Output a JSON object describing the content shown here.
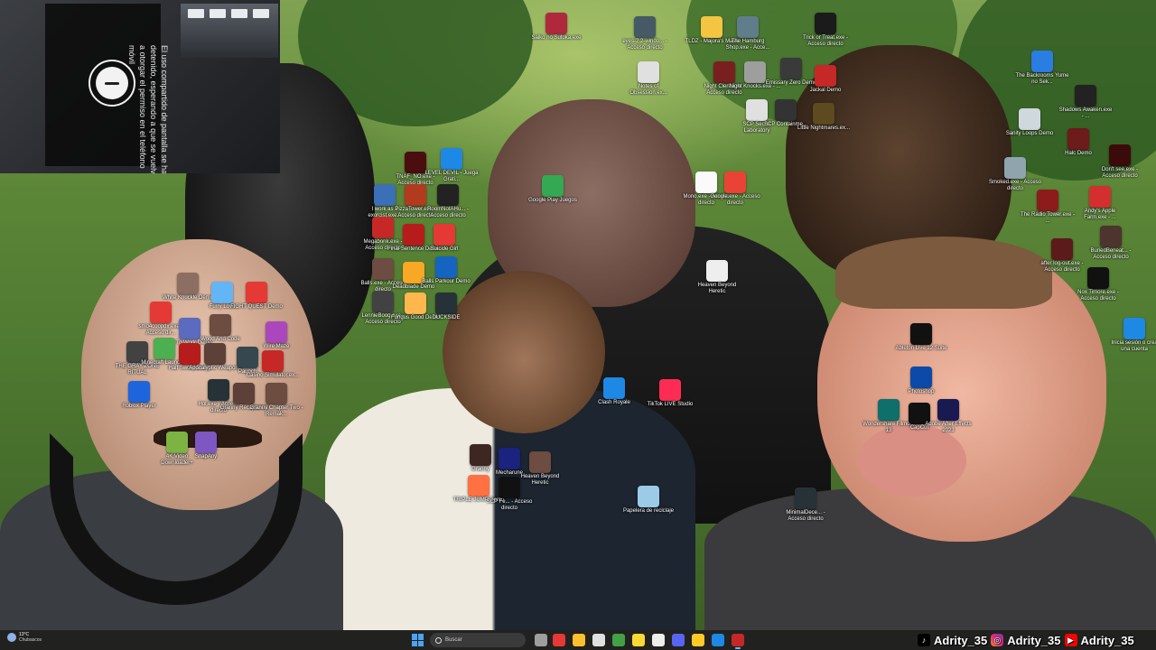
{
  "colors": {
    "taskbar_bg": "#202020",
    "accent": "#4ca3f0",
    "icon_label": "#ffffff"
  },
  "webcam": {
    "text": "El uso compartido de pantalla se ha detenido, esperando a que se vuelva a otorgar el permiso en el teléfono móvil",
    "icon": "screen-share-paused-icon"
  },
  "desktop_icons": [
    {
      "id": "saiko",
      "label": "Saiko no Sutoka.exe",
      "color": "#b0283c",
      "icon": "game-icon"
    },
    {
      "id": "eyes",
      "label": "eyes-2.2-windo... - Acceso directo",
      "color": "#455a64",
      "icon": "unity-icon"
    },
    {
      "id": "tldz",
      "label": "TLDZ - Majora's Mask",
      "color": "#f4c542",
      "icon": "folder-icon"
    },
    {
      "id": "hamburgshop",
      "label": "The Hamburg Shop.exe - Acce...",
      "color": "#607d8b",
      "icon": "unity-icon"
    },
    {
      "id": "trickortreat",
      "label": "Trick or Treat.exe - Acceso directo",
      "color": "#1b1b1b",
      "icon": "game-icon"
    },
    {
      "id": "backrooms",
      "label": "The Backrooms Yume no Sek...",
      "color": "#2a7de1",
      "icon": "game-icon"
    },
    {
      "id": "notesobsession",
      "label": "Notes of Obsession.ex...",
      "color": "#e0e0e0",
      "icon": "game-icon"
    },
    {
      "id": "nightclerk",
      "label": "Night Clerk.exe - Acceso directo",
      "color": "#7a1f1f",
      "icon": "game-icon"
    },
    {
      "id": "nightknocks",
      "label": "Night Knocks.exe - ...",
      "color": "#9e9e9e",
      "icon": "unity-icon"
    },
    {
      "id": "emissaryzero",
      "label": "Emissary Zero Demo",
      "color": "#3a3a3a",
      "icon": "game-icon"
    },
    {
      "id": "jackal",
      "label": "Jackal Demo",
      "color": "#c62828",
      "icon": "game-icon"
    },
    {
      "id": "shadowsawaken",
      "label": "Shadows Awaken.exe - ...",
      "color": "#222222",
      "icon": "game-icon"
    },
    {
      "id": "scpsecret",
      "label": "SCP Secret Laboratory",
      "color": "#e0e0e0",
      "icon": "game-icon"
    },
    {
      "id": "scpcontain",
      "label": "SCP Containme...",
      "color": "#333333",
      "icon": "game-icon"
    },
    {
      "id": "littlenightmares",
      "label": "Little Nightmares.ex...",
      "color": "#5d4a1f",
      "icon": "game-icon"
    },
    {
      "id": "sanityloops",
      "label": "Sanity Loops Demo",
      "color": "#cfd8dc",
      "icon": "game-icon"
    },
    {
      "id": "halcdemo",
      "label": "Halc Demo",
      "color": "#6d1b1b",
      "icon": "game-icon"
    },
    {
      "id": "dontsee",
      "label": "Don't see.exe - Acceso directo",
      "color": "#3b0a0a",
      "icon": "game-icon"
    },
    {
      "id": "tnaf",
      "label": "TNAF_NO.exe - Acceso directo",
      "color": "#4a0e0e",
      "icon": "game-icon"
    },
    {
      "id": "leveldevil",
      "label": "LEVEL DEVIL - Juega Grati...",
      "color": "#1e88e5",
      "icon": "edge-icon"
    },
    {
      "id": "googleplay",
      "label": "Google Play Juegos",
      "color": "#34a853",
      "icon": "google-play-icon"
    },
    {
      "id": "mono",
      "label": "Mono.exe - Acceso directo",
      "color": "#fafafa",
      "icon": "game-icon"
    },
    {
      "id": "googleexe",
      "label": "Google.exe - Acceso directo",
      "color": "#ea4335",
      "icon": "google-icon"
    },
    {
      "id": "smoked",
      "label": "Smoked.exe - Acceso directo",
      "color": "#90a4ae",
      "icon": "unity-icon"
    },
    {
      "id": "theradiotower",
      "label": "The Radio Tower.exe - ...",
      "color": "#8e1b1b",
      "icon": "game-icon"
    },
    {
      "id": "andysapple",
      "label": "Andy's Apple Farm.exe - ...",
      "color": "#d32f2f",
      "icon": "game-icon"
    },
    {
      "id": "iworkasa",
      "label": "I work as a exorcist.exe...",
      "color": "#3b6fb6",
      "icon": "game-icon"
    },
    {
      "id": "pizzatower",
      "label": "PizzaTower.exe - Acceso directo",
      "color": "#b23a1e",
      "icon": "game-icon"
    },
    {
      "id": "roomnot",
      "label": "RoomNotAHu... - Acceso directo",
      "color": "#222222",
      "icon": "game-icon"
    },
    {
      "id": "megabonk",
      "label": "Megabonk.exe - Acceso directo",
      "color": "#c62828",
      "icon": "game-icon"
    },
    {
      "id": "finalsentence",
      "label": "Final Sentence Demo",
      "color": "#b71c1c",
      "icon": "game-icon"
    },
    {
      "id": "suicidegirl",
      "label": "Suicide Girl",
      "color": "#e53935",
      "icon": "game-icon"
    },
    {
      "id": "buriedbeneath",
      "label": "BuriedBeneat... - Acceso directo",
      "color": "#4e342e",
      "icon": "game-icon"
    },
    {
      "id": "afterlogout",
      "label": "after log-out.exe - Acceso directo",
      "color": "#5d1a1a",
      "icon": "game-icon"
    },
    {
      "id": "heavenbeyond",
      "label": "Heaven Beyond Heretic",
      "color": "#eeeeee",
      "icon": "game-icon"
    },
    {
      "id": "nostimore",
      "label": "Nox Timore.exe - Acceso directo",
      "color": "#111111",
      "icon": "game-icon"
    },
    {
      "id": "balls",
      "label": "Balls.exe - Acceso directo",
      "color": "#6d4c41",
      "icon": "game-icon"
    },
    {
      "id": "deadblade",
      "label": "Deadblade Demo",
      "color": "#f9a825",
      "icon": "game-icon"
    },
    {
      "id": "ballsparkour",
      "label": "Balls Parkour Demo",
      "color": "#1565c0",
      "icon": "game-icon"
    },
    {
      "id": "lennieboog",
      "label": "LennieBoog.exe - Acceso directo",
      "color": "#424242",
      "icon": "game-icon"
    },
    {
      "id": "fungusgood",
      "label": "Fungus Good Demo",
      "color": "#ffb74d",
      "icon": "game-icon"
    },
    {
      "id": "duckside",
      "label": "DUCKSIDE",
      "color": "#263238",
      "icon": "game-icon"
    },
    {
      "id": "iniciasesion",
      "label": "Inicia sesión o crea una cuenta",
      "color": "#1e88e5",
      "icon": "edge-icon"
    },
    {
      "id": "whiteknuckle",
      "label": "White Knuckle Demo",
      "color": "#8d6e63",
      "icon": "game-icon"
    },
    {
      "id": "furrylove",
      "label": "Furry Love",
      "color": "#64b5f6",
      "icon": "game-icon"
    },
    {
      "id": "fightquest",
      "label": "FIGHT QUEST Demo",
      "color": "#e53935",
      "icon": "game-icon"
    },
    {
      "id": "smo4",
      "label": "smo4coopdx.exe - Acceso dir...",
      "color": "#e53935",
      "icon": "game-icon"
    },
    {
      "id": "gotowork",
      "label": "Go To Work Demo",
      "color": "#5c6bc0",
      "icon": "game-icon"
    },
    {
      "id": "woodandcode",
      "label": "Wood And Code",
      "color": "#6d4c41",
      "icon": "game-icon"
    },
    {
      "id": "wiremaze",
      "label": "Wire Maze",
      "color": "#ab47bc",
      "icon": "game-icon"
    },
    {
      "id": "grayzone",
      "label": "THE GRAY ZONE RITUAL",
      "color": "#424242",
      "icon": "game-icon"
    },
    {
      "id": "minecraft",
      "label": "Minecraft Launcher",
      "color": "#4caf50",
      "icon": "minecraft-icon"
    },
    {
      "id": "halflife",
      "label": "Half Sword Demo",
      "color": "#b71c1c",
      "icon": "game-icon"
    },
    {
      "id": "apocalyptic",
      "label": "Apocalyptic Weapons",
      "color": "#5d4037",
      "icon": "game-icon"
    },
    {
      "id": "paunch",
      "label": "Paunch",
      "color": "#37474f",
      "icon": "game-icon"
    },
    {
      "id": "casino",
      "label": "Casino Simulator.ex...",
      "color": "#c62828",
      "icon": "game-icon"
    },
    {
      "id": "roblox",
      "label": "Roblox Player",
      "color": "#1e64dc",
      "icon": "roblox-icon"
    },
    {
      "id": "hollowexe",
      "label": "Hol.exe - Acceso directo",
      "color": "#263238",
      "icon": "game-icon"
    },
    {
      "id": "granny",
      "label": "Granny Recaptured",
      "color": "#5d4037",
      "icon": "game-icon"
    },
    {
      "id": "grannych2",
      "label": "Granny Chapter Two - Remak...",
      "color": "#6d4c41",
      "icon": "game-icon"
    },
    {
      "id": "clashroyale",
      "label": "Clash Royale",
      "color": "#1e88e5",
      "icon": "game-icon"
    },
    {
      "id": "tiktoklive",
      "label": "TikTok LIVE Studio",
      "color": "#fe2c55",
      "icon": "tiktok-icon"
    },
    {
      "id": "abletonlive",
      "label": "Ableton Live 12 Suite",
      "color": "#111111",
      "icon": "ableton-icon"
    },
    {
      "id": "photoshop",
      "label": "Photoshop",
      "color": "#0b4aa8",
      "icon": "photoshop-icon"
    },
    {
      "id": "filmora",
      "label": "Wondershare Filmora 13",
      "color": "#0f6f6a",
      "icon": "filmora-icon"
    },
    {
      "id": "capcut",
      "label": "CapCut",
      "color": "#111111",
      "icon": "capcut-icon"
    },
    {
      "id": "aftereffects",
      "label": "Adobe After Effects 2023",
      "color": "#1a1a52",
      "icon": "after-effects-icon"
    },
    {
      "id": "minimalrec",
      "label": "MinimalDece... - Acceso directo",
      "color": "#263238",
      "icon": "unreal-icon"
    },
    {
      "id": "fourkvideo",
      "label": "4K Video Downloader+",
      "color": "#7cb342",
      "icon": "download-icon"
    },
    {
      "id": "snapany",
      "label": "SnapAny",
      "color": "#7e57c2",
      "icon": "camera-icon"
    },
    {
      "id": "granny3",
      "label": "Granny",
      "color": "#3e2723",
      "icon": "game-icon"
    },
    {
      "id": "mecharune",
      "label": "Mecharune",
      "color": "#1a237e",
      "icon": "game-icon"
    },
    {
      "id": "heavenheretic2",
      "label": "Heaven Beyond Heretic",
      "color": "#6d4c41",
      "icon": "game-icon"
    },
    {
      "id": "triplejump",
      "label": "TRIPLE JUMP Demo",
      "color": "#ff7043",
      "icon": "game-icon"
    },
    {
      "id": "unrealshort",
      "label": "SCP Fe... - Acceso directo",
      "color": "#111111",
      "icon": "unreal-icon"
    },
    {
      "id": "papelera",
      "label": "Papelera de reciclaje",
      "color": "#9ccbe8",
      "icon": "recycle-bin-icon"
    }
  ],
  "taskbar": {
    "weather_temp": "13°C",
    "weather_desc": "Chubascos",
    "search_placeholder": "Buscar",
    "apps": [
      {
        "name": "task-view-icon",
        "color": "#9e9e9e"
      },
      {
        "name": "opera-icon",
        "color": "#e53935"
      },
      {
        "name": "chrome-icon",
        "color": "#fbc02d"
      },
      {
        "name": "file-icon",
        "color": "#e0e0e0"
      },
      {
        "name": "xbox-icon",
        "color": "#43a047"
      },
      {
        "name": "norton-icon",
        "color": "#fdd835"
      },
      {
        "name": "capcut-icon",
        "color": "#eeeeee"
      },
      {
        "name": "discord-icon",
        "color": "#5865f2"
      },
      {
        "name": "file-explorer-icon",
        "color": "#ffca28"
      },
      {
        "name": "edge-icon",
        "color": "#1e88e5"
      },
      {
        "name": "obs-icon",
        "color": "#c62828"
      }
    ]
  },
  "social": {
    "tiktok": "Adrity_35",
    "instagram": "Adrity_35",
    "youtube": "Adrity_35"
  }
}
